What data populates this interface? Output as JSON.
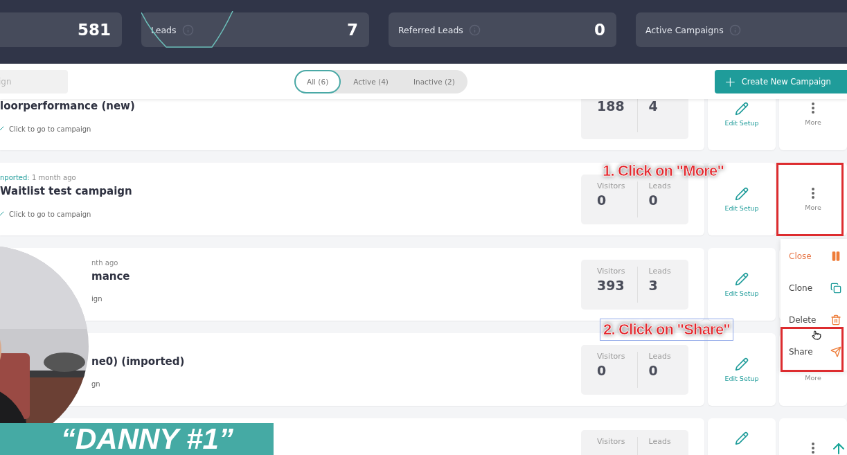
{
  "stats": [
    {
      "kind": "plain",
      "value": "581"
    },
    {
      "kind": "trend",
      "label": "Leads",
      "value": "7"
    },
    {
      "kind": "plain",
      "label": "Referred Leads",
      "value": "0"
    },
    {
      "kind": "plain",
      "label": "Active Campaigns"
    }
  ],
  "toolbar": {
    "search": {
      "placeholder": "ign"
    },
    "tabs": [
      {
        "label": "All (6)",
        "selected": true
      },
      {
        "label": "Active (4)",
        "selected": false
      },
      {
        "label": "Inactive (2)",
        "selected": false
      }
    ],
    "create_button": {
      "icon": "+",
      "label": "Create New Campaign"
    }
  },
  "campaigns": [
    {
      "name": "loorperformance (new)",
      "link": "Click to go to campaign",
      "stats": [
        {
          "value": "188"
        },
        {
          "value": "4"
        }
      ],
      "edit": "Edit Setup",
      "more": "More"
    },
    {
      "meta_tag": "nported:",
      "meta_time": "1 month ago",
      "name": "Waitlist test campaign",
      "link": "Click to go to campaign",
      "stats": [
        {
          "label": "Visitors",
          "value": "0"
        },
        {
          "label": "Leads",
          "value": "0"
        }
      ],
      "edit": "Edit Setup",
      "more": "More"
    },
    {
      "meta_time": "nth ago",
      "name": "mance",
      "link": "ign",
      "stats": [
        {
          "label": "Visitors",
          "value": "393"
        },
        {
          "label": "Leads",
          "value": "3"
        }
      ],
      "edit": "Edit Setup"
    },
    {
      "name": "ne0) (imported)",
      "link": "gn",
      "stats": [
        {
          "label": "Visitors",
          "value": "0"
        },
        {
          "label": "Leads",
          "value": "0"
        }
      ],
      "edit": "Edit Setup",
      "more": "More"
    },
    {
      "stats": [
        {
          "label": "Visitors"
        },
        {
          "label": "Leads"
        }
      ]
    }
  ],
  "menu": [
    {
      "kind": "close",
      "label": "Close"
    },
    {
      "kind": "clone",
      "label": "Clone"
    },
    {
      "kind": "delete",
      "label": "Delete"
    },
    {
      "kind": "share",
      "label": "Share"
    }
  ],
  "annotations": [
    {
      "kind": "step",
      "text": "1. Click on \"More\""
    },
    {
      "kind": "step",
      "text": "2. Click on \"Share\""
    }
  ],
  "video": {
    "caption": "“DANNY #1”"
  }
}
